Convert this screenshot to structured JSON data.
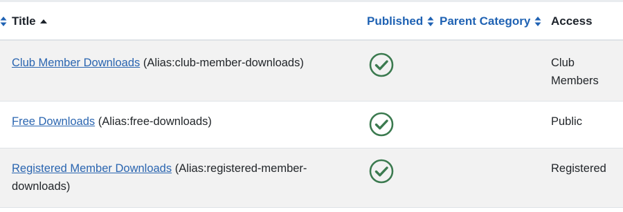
{
  "table": {
    "columns": {
      "title": "Title",
      "published": "Published",
      "parent_category": "Parent Category",
      "access": "Access"
    },
    "rows": [
      {
        "title": "Club Member Downloads",
        "alias": "(Alias:club-member-downloads)",
        "published": "published-check-icon",
        "access": "Club Members"
      },
      {
        "title": "Free Downloads",
        "alias": "(Alias:free-downloads)",
        "published": "published-check-icon",
        "access": "Public"
      },
      {
        "title": "Registered Member Downloads",
        "alias": "(Alias:registered-member-downloads)",
        "published": "published-check-icon",
        "access": "Registered"
      }
    ]
  },
  "colors": {
    "link": "#2a65b0",
    "header_link": "#1f62b3",
    "published_green": "#3b7a4f",
    "row_stripe": "#f2f2f2"
  }
}
